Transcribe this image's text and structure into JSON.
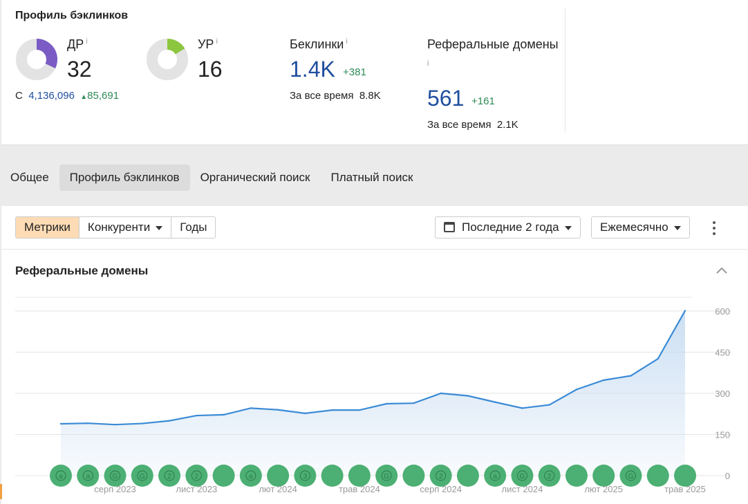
{
  "header": {
    "title": "Профиль бэклинков"
  },
  "metrics": {
    "dr": {
      "label": "ДР",
      "info": "i",
      "value": "32",
      "color": "#7b5cc4"
    },
    "ur": {
      "label": "УР",
      "info": "i",
      "value": "16",
      "color": "#8cc63f"
    },
    "rank": {
      "prefix": "С",
      "value": "4,136,096",
      "delta": "85,691"
    },
    "backlinks": {
      "label": "Беклинки",
      "info": "i",
      "value": "1.4K",
      "delta": "+381",
      "all_time_label": "За все время",
      "all_time_value": "8.8K"
    },
    "ref_domains": {
      "label": "Реферальные домены",
      "info": "i",
      "value": "561",
      "delta": "+161",
      "all_time_label": "За все время",
      "all_time_value": "2.1K"
    }
  },
  "tabs": [
    "Общее",
    "Профиль бэклинков",
    "Органический поиск",
    "Платный поиск"
  ],
  "active_tab": "Профиль бэклинков",
  "toolbar": {
    "segments": [
      "Метрики",
      "Конкуренти",
      "Годы"
    ],
    "active_segment": "Метрики",
    "period": "Последние 2 года",
    "granularity": "Ежемесячно"
  },
  "section": {
    "title": "Реферальные домены"
  },
  "colors": {
    "line": "#3a8bd6",
    "area_top": "#c9ddf2",
    "marker": "#4caf73",
    "accent_active": "#fddbb4"
  },
  "chart_data": {
    "type": "area",
    "title": "Реферальные домены",
    "x": [
      "2023-06",
      "2023-07",
      "2023-08",
      "2023-09",
      "2023-10",
      "2023-11",
      "2023-12",
      "2024-01",
      "2024-02",
      "2024-03",
      "2024-04",
      "2024-05",
      "2024-06",
      "2024-07",
      "2024-08",
      "2024-09",
      "2024-10",
      "2024-11",
      "2024-12",
      "2025-01",
      "2025-02",
      "2025-03",
      "2025-04",
      "2025-05"
    ],
    "values": [
      189,
      191,
      186,
      190,
      200,
      219,
      222,
      246,
      240,
      227,
      239,
      239,
      262,
      264,
      300,
      291,
      268,
      246,
      258,
      314,
      348,
      364,
      426,
      601
    ],
    "x_tick_labels": [
      "серп 2023",
      "лист 2023",
      "лют 2024",
      "трав 2024",
      "серп 2024",
      "лист 2024",
      "лют 2025",
      "трав 2025"
    ],
    "y_ticks": [
      0,
      150,
      300,
      450,
      600
    ],
    "ylim": [
      0,
      650
    ],
    "y_axis_position": "right",
    "grid": true,
    "event_markers": [
      "a",
      "a",
      "G",
      "G",
      "2",
      "2",
      "",
      "a",
      "",
      "3",
      "",
      "",
      "G",
      "",
      "2",
      "",
      "a",
      "G",
      "2",
      "",
      "",
      "G",
      "",
      ""
    ]
  }
}
